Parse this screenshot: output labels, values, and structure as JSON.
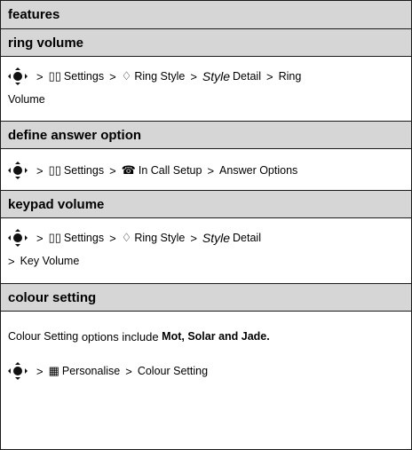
{
  "header": {
    "title": "features"
  },
  "sections": {
    "ring_volume": {
      "title": "ring volume",
      "path": [
        "Settings",
        "Ring Style",
        "Style",
        "Detail",
        "Ring",
        "Volume"
      ]
    },
    "answer_option": {
      "title": "define answer option",
      "path": [
        "Settings",
        "In Call Setup",
        "Answer Options"
      ]
    },
    "keypad_volume": {
      "title": "keypad volume",
      "path": [
        "Settings",
        "Ring Style",
        "Style",
        "Detail",
        "Key Volume"
      ]
    },
    "colour_setting": {
      "title": "colour setting",
      "desc_strong": "Colour Setting",
      "desc_plain": " options include ",
      "desc_options": "Mot, Solar and Jade.",
      "path": [
        "Personalise",
        "Colour Setting"
      ]
    }
  },
  "symbols": {
    "separator": ">"
  },
  "icons": {
    "nav_key": "nav-key-icon",
    "settings": "settings-icon",
    "ring_style": "ring-style-icon",
    "call_setup": "call-setup-icon",
    "personalise": "personalise-icon"
  }
}
